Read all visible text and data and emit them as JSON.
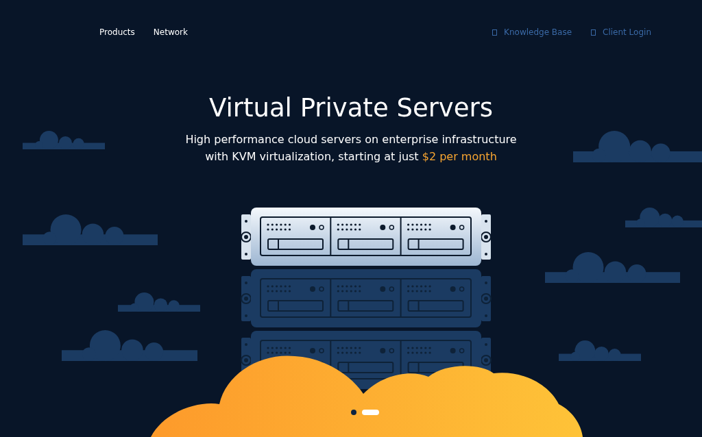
{
  "nav": {
    "left": [
      {
        "label": "Products"
      },
      {
        "label": "Network"
      }
    ],
    "right": [
      {
        "label": "Knowledge Base"
      },
      {
        "label": "Client Login"
      }
    ]
  },
  "hero": {
    "title": "Virtual Private Servers",
    "subtitle": "High performance cloud servers on enterprise infrastructure with KVM virtualization, starting at just **$2 per month**"
  },
  "carousel": {
    "dots": [
      {
        "selected": false
      },
      {
        "selected": true
      }
    ]
  }
}
